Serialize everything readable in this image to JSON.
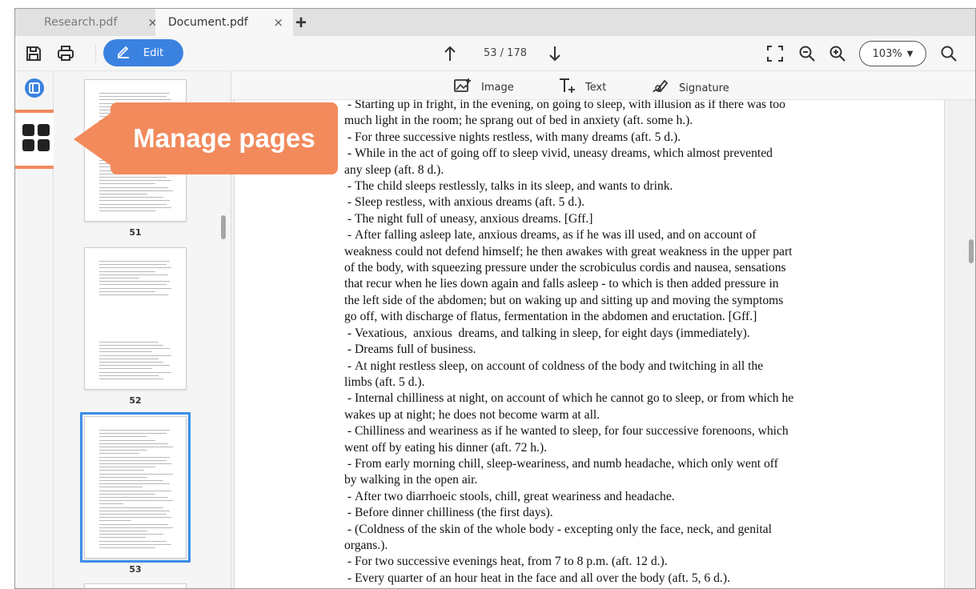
{
  "tabs": [
    {
      "label": "Research.pdf",
      "close": "×",
      "active": false
    },
    {
      "label": "Document.pdf",
      "close": "×",
      "active": true
    }
  ],
  "tab_add": "+",
  "toolbar": {
    "edit_label": "Edit",
    "page_indicator": "53 / 178",
    "zoom_value": "103%"
  },
  "edit_tools": {
    "image_label": "Image",
    "text_label": "Text",
    "signature_label": "Signature"
  },
  "thumbnails": [
    {
      "page": "51",
      "selected": false
    },
    {
      "page": "52",
      "selected": false
    },
    {
      "page": "53",
      "selected": true
    }
  ],
  "callout": {
    "text": "Manage pages"
  },
  "document_lines": [
    " - Starting up in fright, in the evening, on going to sleep, with illusion as if there was too",
    "much light in the room; he sprang out of bed in anxiety (aft. some h.).",
    " - For three successive nights restless, with many dreams (aft. 5 d.).",
    " - While in the act of going off to sleep vivid, uneasy dreams, which almost prevented",
    "any sleep (aft. 8 d.).",
    " - The child sleeps restlessly, talks in its sleep, and wants to drink.",
    " - Sleep restless, with anxious dreams (aft. 5 d.).",
    " - The night full of uneasy, anxious dreams. [Gff.]",
    " - After falling asleep late, anxious dreams, as if he was ill used, and on account of",
    "weakness could not defend himself; he then awakes with great weakness in the upper part",
    "of the body, with squeezing pressure under the scrobiculus cordis and nausea, sensations",
    "that recur when he lies down again and falls asleep - to which is then added pressure in",
    "the left side of the abdomen; but on waking up and sitting up and moving the symptoms",
    "go off, with discharge of flatus, fermentation in the abdomen and eructation. [Gff.]",
    " - Vexatious,  anxious  dreams, and talking in sleep, for eight days (immediately).",
    " - Dreams full of business.",
    " - At night restless sleep, on account of coldness of the body and twitching in all the",
    "limbs (aft. 5 d.).",
    " - Internal chilliness at night, on account of which he cannot go to sleep, or from which he",
    "wakes up at night; he does not become warm at all.",
    " - Chilliness and weariness as if he wanted to sleep, for four successive forenoons, which",
    "went off by eating his dinner (aft. 72 h.).",
    " - From early morning chill, sleep-weariness, and numb headache, which only went off",
    "by walking in the open air.",
    " - After two diarrhoeic stools, chill, great weariness and headache.",
    " - Before dinner chilliness (the first days).",
    " - (Coldness of the skin of the whole body - excepting only the face, neck, and genital",
    "organs.).",
    " - For two successive evenings heat, from 7 to 8 p.m. (aft. 12 d.).",
    " - Every quarter of an hour heat in the face and all over the body (aft. 5, 6 d.)."
  ],
  "colors": {
    "accent": "#3b82e0",
    "callout": "#f28a5c",
    "selection": "#3b8ee8"
  }
}
